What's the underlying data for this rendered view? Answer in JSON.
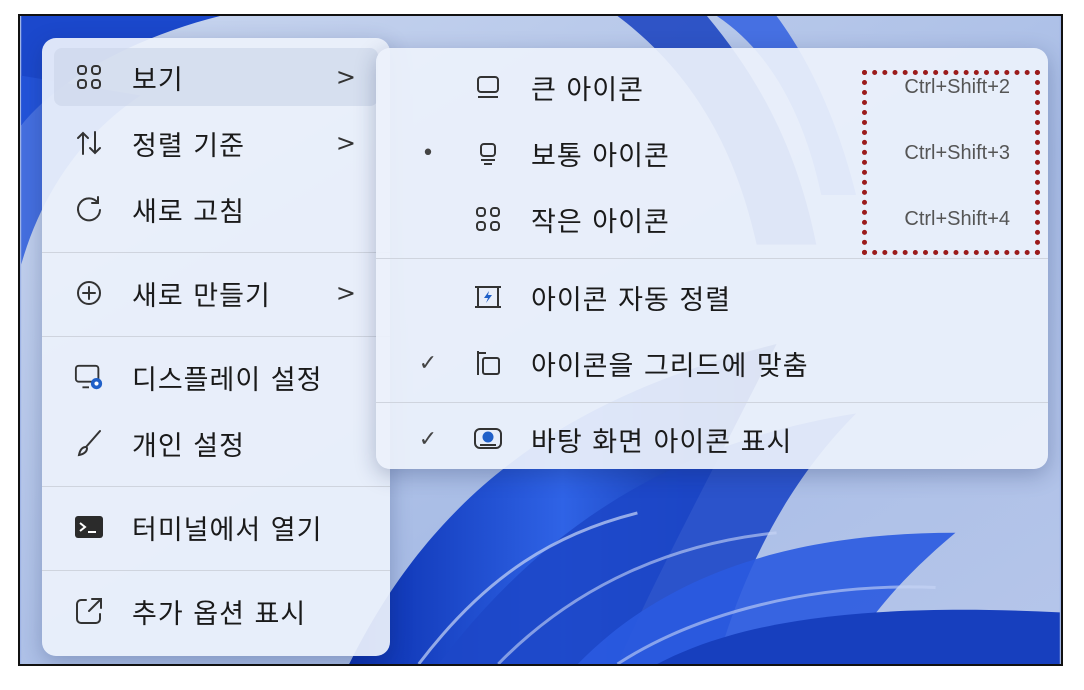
{
  "main_menu": {
    "items": [
      {
        "label": "보기",
        "icon": "grid-icon",
        "has_submenu": true
      },
      {
        "label": "정렬 기준",
        "icon": "sort-icon",
        "has_submenu": true
      },
      {
        "label": "새로 고침",
        "icon": "refresh-icon",
        "has_submenu": false
      },
      {
        "label": "새로 만들기",
        "icon": "add-circle-icon",
        "has_submenu": true
      },
      {
        "label": "디스플레이 설정",
        "icon": "display-settings-icon",
        "has_submenu": false
      },
      {
        "label": "개인 설정",
        "icon": "brush-icon",
        "has_submenu": false
      },
      {
        "label": "터미널에서 열기",
        "icon": "terminal-icon",
        "has_submenu": false
      },
      {
        "label": "추가 옵션 표시",
        "icon": "open-external-icon",
        "has_submenu": false
      }
    ],
    "chevron": ">"
  },
  "view_submenu": {
    "items": [
      {
        "label": "큰 아이콘",
        "shortcut": "Ctrl+Shift+2",
        "icon": "large-icons-icon",
        "mark": ""
      },
      {
        "label": "보통 아이콘",
        "shortcut": "Ctrl+Shift+3",
        "icon": "medium-icons-icon",
        "mark": "•"
      },
      {
        "label": "작은 아이콘",
        "shortcut": "Ctrl+Shift+4",
        "icon": "small-icons-icon",
        "mark": ""
      },
      {
        "label": "아이콘 자동 정렬",
        "shortcut": "",
        "icon": "auto-arrange-icon",
        "mark": ""
      },
      {
        "label": "아이콘을 그리드에 맞춤",
        "shortcut": "",
        "icon": "align-grid-icon",
        "mark": "✓"
      },
      {
        "label": "바탕 화면 아이콘 표시",
        "shortcut": "",
        "icon": "show-desktop-icons-icon",
        "mark": "✓"
      }
    ]
  },
  "colors": {
    "annotation_border": "#9b1b1b",
    "menu_bg": "#ecf1fb",
    "wallpaper_blue": "#1a4fd0"
  }
}
